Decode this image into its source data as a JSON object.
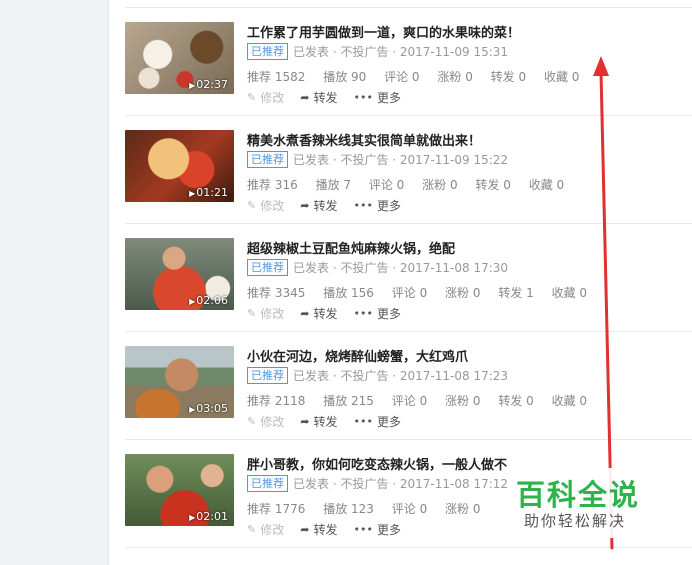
{
  "items": [
    {
      "title": "工作累了用芋圆做到一道，爽口的水果味的菜！",
      "badge": "已推荐",
      "meta": "已发表 · 不投广告 · 2017-11-09 15:31",
      "duration": "02:37",
      "stats": [
        "推荐 1582",
        "播放 90",
        "评论 0",
        "涨粉 0",
        "转发 0",
        "收藏 0"
      ],
      "actions": {
        "edit": "修改",
        "share": "转发",
        "more": "更多"
      }
    },
    {
      "title": "精美水煮香辣米线其实很简单就做出来！",
      "badge": "已推荐",
      "meta": "已发表 · 不投广告 · 2017-11-09 15:22",
      "duration": "01:21",
      "stats": [
        "推荐 316",
        "播放 7",
        "评论 0",
        "涨粉 0",
        "转发 0",
        "收藏 0"
      ],
      "actions": {
        "edit": "修改",
        "share": "转发",
        "more": "更多"
      }
    },
    {
      "title": "超级辣椒土豆配鱼炖麻辣火锅，绝配",
      "badge": "已推荐",
      "meta": "已发表 · 不投广告 · 2017-11-08 17:30",
      "duration": "02:06",
      "stats": [
        "推荐 3345",
        "播放 156",
        "评论 0",
        "涨粉 0",
        "转发 1",
        "收藏 0"
      ],
      "actions": {
        "edit": "修改",
        "share": "转发",
        "more": "更多"
      }
    },
    {
      "title": "小伙在河边，烧烤醉仙螃蟹，大红鸡爪",
      "badge": "已推荐",
      "meta": "已发表 · 不投广告 · 2017-11-08 17:23",
      "duration": "03:05",
      "stats": [
        "推荐 2118",
        "播放 215",
        "评论 0",
        "涨粉 0",
        "转发 0",
        "收藏 0"
      ],
      "actions": {
        "edit": "修改",
        "share": "转发",
        "more": "更多"
      }
    },
    {
      "title": "胖小哥教，你如何吃变态辣火锅，一般人做不",
      "badge": "已推荐",
      "meta": "已发表 · 不投广告 · 2017-11-08 17:12",
      "duration": "02:01",
      "stats": [
        "推荐 1776",
        "播放 123",
        "评论 0",
        "涨粉 0"
      ],
      "actions": {
        "edit": "修改",
        "share": "转发",
        "more": "更多"
      }
    }
  ],
  "watermark": {
    "title": "百科全说",
    "subtitle": "助你轻松解决"
  },
  "colors": {
    "badge": "#4e97e8",
    "arrow": "#e03030",
    "watermark": "#2db34a"
  }
}
